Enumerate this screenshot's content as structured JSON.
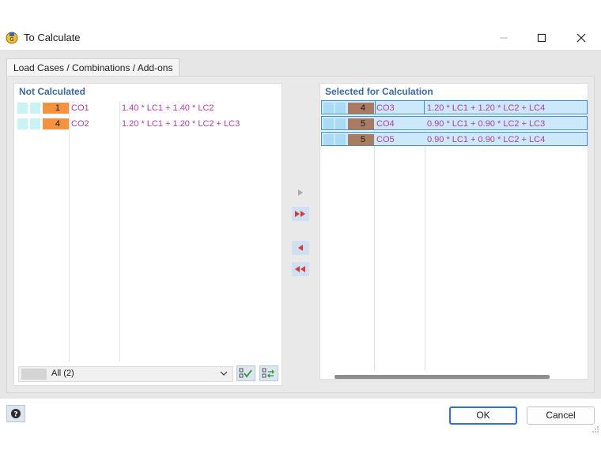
{
  "window": {
    "title": "To Calculate",
    "app_icon": "rfem-calculate-icon",
    "controls": [
      "minimize-icon",
      "maximize-icon",
      "close-icon"
    ]
  },
  "tabs": [
    {
      "label": "Load Cases / Combinations / Add-ons",
      "active": true
    }
  ],
  "not_calculated": {
    "header": "Not Calculated",
    "rows": [
      {
        "num": "1",
        "num_color": "#f4923f",
        "code": "CO1",
        "description": "1.40 * LC1 + 1.40 * LC2"
      },
      {
        "num": "4",
        "num_color": "#f4923f",
        "code": "CO2",
        "description": "1.20 * LC1 + 1.20 * LC2 + LC3"
      }
    ],
    "filter_value": "All (2)"
  },
  "selected_for_calculation": {
    "header": "Selected for Calculation",
    "rows": [
      {
        "num": "4",
        "num_color": "#a87b62",
        "code": "CO3",
        "description": "1.20 * LC1 + 1.20 * LC2 + LC4"
      },
      {
        "num": "5",
        "num_color": "#a87b62",
        "code": "CO4",
        "description": "0.90 * LC1 + 0.90 * LC2 + LC3"
      },
      {
        "num": "5",
        "num_color": "#a87b62",
        "code": "CO5",
        "description": "0.90 * LC1 + 0.90 * LC2 + LC4"
      }
    ]
  },
  "transfer_buttons": [
    "move-selected-right-icon",
    "move-all-right-icon",
    "move-selected-left-icon",
    "move-all-left-icon"
  ],
  "footer": {
    "ok_label": "OK",
    "cancel_label": "Cancel"
  },
  "colors": {
    "accent": "#3b68a6",
    "selection": "#cce8fb",
    "code_text": "#b03ca8"
  }
}
